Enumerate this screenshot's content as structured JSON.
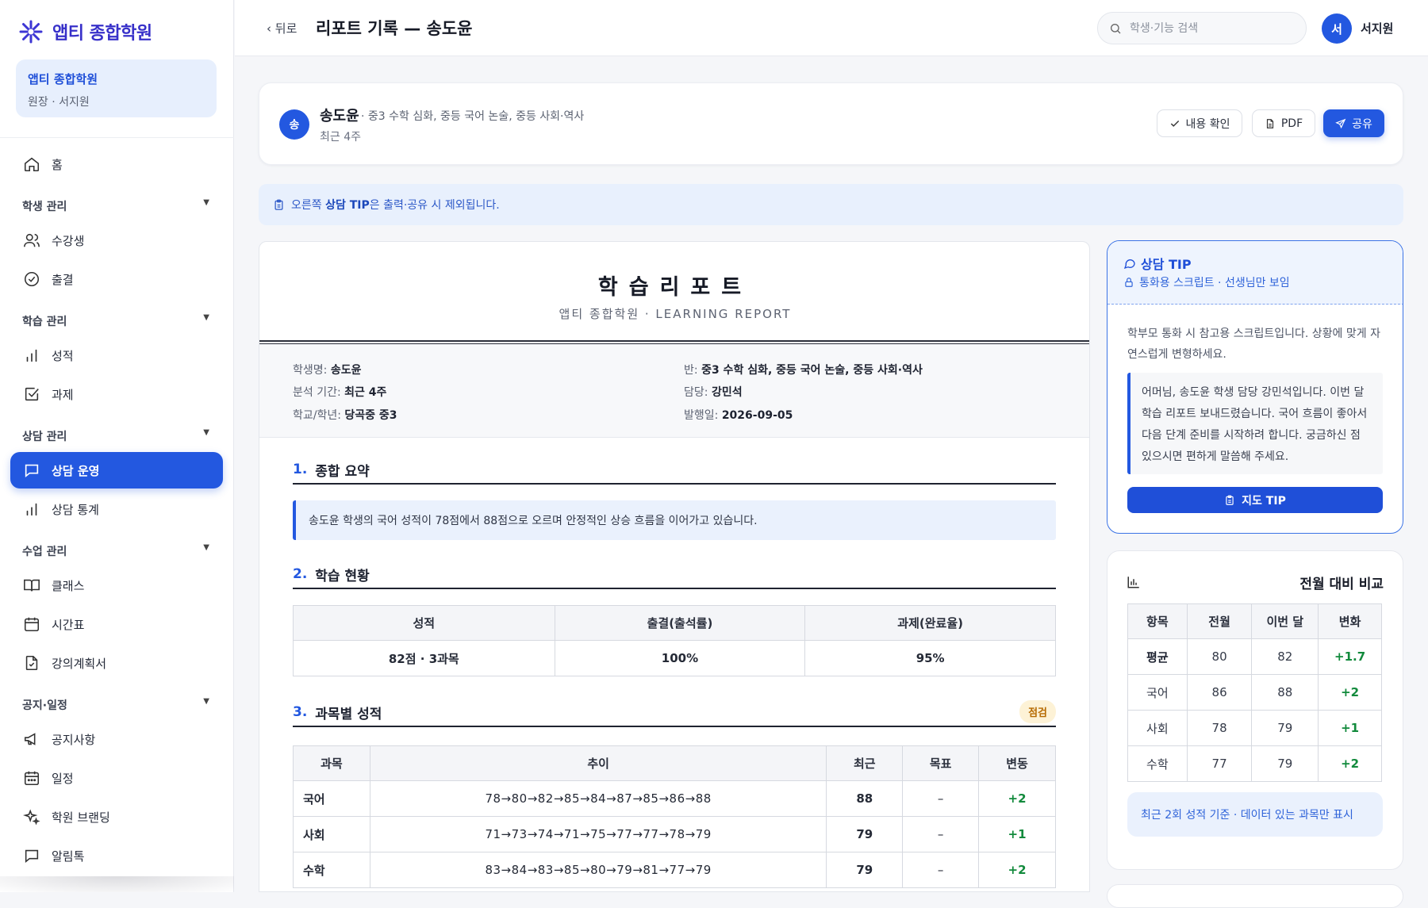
{
  "brand": {
    "name": "앱티 종합학원"
  },
  "org": {
    "name": "앱티 종합학원",
    "role": "원장 · 서지원"
  },
  "nav": {
    "home": "홈",
    "group_students": "학생 관리",
    "students": "수강생",
    "attendance": "출결",
    "group_learning": "학습 관리",
    "grades": "성적",
    "assignments": "과제",
    "group_counsel": "상담 관리",
    "counsel_ops": "상담 운영",
    "counsel_stats": "상담 통계",
    "group_class": "수업 관리",
    "classes": "클래스",
    "timetable": "시간표",
    "syllabus": "강의계획서",
    "group_notice": "공지·일정",
    "notices": "공지사항",
    "schedule": "일정",
    "branding": "학원 브랜딩",
    "alimtalk": "알림톡",
    "caret": "▼"
  },
  "topbar": {
    "back": "‹ 뒤로",
    "title": "리포트 기록 — 송도윤",
    "search_placeholder": "학생·기능 검색",
    "user_initial": "서",
    "user_name": "서지원"
  },
  "student": {
    "initial": "송",
    "name": "송도윤",
    "classes": "· 중3 수학 심화, 중등 국어 논술, 중등 사회·역사",
    "period": "최근 4주",
    "btn_confirm": "내용 확인",
    "btn_pdf": "PDF",
    "btn_share": "공유"
  },
  "notice": {
    "pre": "오른쪽 ",
    "bold": "상담 TIP",
    "post": "은 출력·공유 시 제외됩니다."
  },
  "report": {
    "title": "학습리포트",
    "subtitle": "앱티 종합학원 · LEARNING REPORT",
    "meta": {
      "student_label": "학생명: ",
      "student": "송도윤",
      "period_label": "분석 기간: ",
      "period": "최근 4주",
      "school_label": "학교/학년: ",
      "school": "당곡중 중3",
      "class_label": "반: ",
      "class": "중3 수학 심화, 중등 국어 논술, 중등 사회·역사",
      "teacher_label": "담당: ",
      "teacher": "강민석",
      "issued_label": "발행일: ",
      "issued": "2026-09-05"
    },
    "s1": {
      "num": "1.",
      "title": "종합 요약",
      "text": "송도윤 학생의 국어 성적이 78점에서 88점으로 오르며 안정적인 상승 흐름을 이어가고 있습니다."
    },
    "s2": {
      "num": "2.",
      "title": "학습 현황",
      "headers": [
        "성적",
        "출결(출석률)",
        "과제(완료율)"
      ],
      "values": [
        "82점 · 3과목",
        "100%",
        "95%"
      ]
    },
    "s3": {
      "num": "3.",
      "title": "과목별 성적",
      "badge": "점검",
      "headers": [
        "과목",
        "추이",
        "최근",
        "목표",
        "변동"
      ],
      "rows": [
        {
          "subject": "국어",
          "trend": "78→80→82→85→84→87→85→86→88",
          "recent": "88",
          "target": "–",
          "change": "+2"
        },
        {
          "subject": "사회",
          "trend": "71→73→74→71→75→77→77→78→79",
          "recent": "79",
          "target": "–",
          "change": "+1"
        },
        {
          "subject": "수학",
          "trend": "83→84→83→85→80→79→81→77→79",
          "recent": "79",
          "target": "–",
          "change": "+2"
        }
      ]
    }
  },
  "tip": {
    "title": "상담 TIP",
    "subtitle": "통화용 스크립트 · 선생님만 보임",
    "intro": "학부모 통화 시 참고용 스크립트입니다. 상황에 맞게 자연스럽게 변형하세요.",
    "script": "어머님, 송도윤 학생 담당 강민석입니다. 이번 달 학습 리포트 보내드렸습니다. 국어 흐름이 좋아서 다음 단계 준비를 시작하려 합니다. 궁금하신 점 있으시면 편하게 말씀해 주세요.",
    "button": "지도 TIP"
  },
  "compare": {
    "title": "전월 대비 비교",
    "headers": [
      "항목",
      "전월",
      "이번 달",
      "변화"
    ],
    "rows": [
      {
        "item": "평균",
        "prev": "80",
        "curr": "82",
        "change": "+1.7"
      },
      {
        "item": "국어",
        "prev": "86",
        "curr": "88",
        "change": "+2"
      },
      {
        "item": "사회",
        "prev": "78",
        "curr": "79",
        "change": "+1"
      },
      {
        "item": "수학",
        "prev": "77",
        "curr": "79",
        "change": "+2"
      }
    ],
    "note": "최근 2회 성적 기준 · 데이터 있는 과목만 표시"
  },
  "colors": {
    "accent": "#2358e0",
    "brand": "#3730c9",
    "positive": "#128a3c",
    "badge": "#b66a00"
  }
}
